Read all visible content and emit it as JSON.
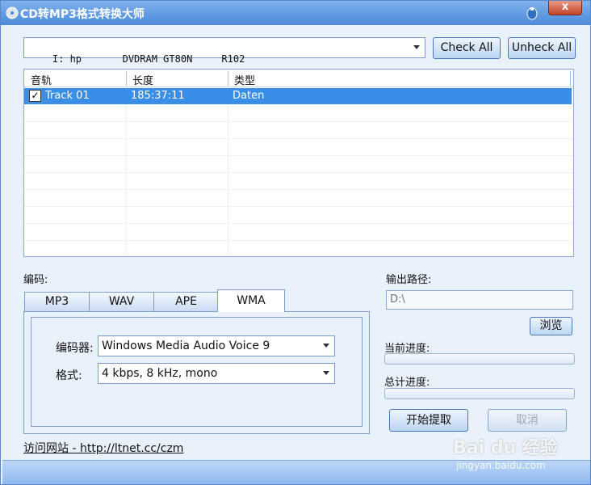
{
  "window": {
    "title": "CD转MP3格式转换大师",
    "close_label": "x"
  },
  "toolbar": {
    "drive_value": "I: hp       DVDRAM GT80N     R102",
    "check_all_label": "Check All",
    "uncheck_all_label": "Unheck All"
  },
  "track_list": {
    "columns": [
      "音轨",
      "长度",
      "类型"
    ],
    "rows": [
      {
        "checked": true,
        "track": "Track 01",
        "length": "185:37:11",
        "type": "Daten"
      }
    ],
    "checkmark": "✓"
  },
  "encoding": {
    "label": "编码:",
    "tabs": [
      "MP3",
      "WAV",
      "APE",
      "WMA"
    ],
    "active_tab": "WMA",
    "encoder_label": "编码器:",
    "encoder_value": "Windows Media Audio Voice 9",
    "format_label": "格式:",
    "format_value": "4 kbps, 8 kHz, mono"
  },
  "output": {
    "path_label": "输出路径:",
    "path_value": "D:\\",
    "browse_label": "浏览",
    "current_progress_label": "当前进度:",
    "total_progress_label": "总计进度:",
    "current_progress": 0,
    "total_progress": 0,
    "start_label": "开始提取",
    "cancel_label": "取消"
  },
  "footer": {
    "visit_site": "访问网站 - http://ltnet.cc/czm"
  },
  "watermark": {
    "brand": "Bai du 经验",
    "url": "jingyan.baidu.com"
  },
  "colors": {
    "titlebar": "#4c8ad9",
    "selection": "#3a8ee6",
    "window_bg": "#e9f1fb"
  }
}
